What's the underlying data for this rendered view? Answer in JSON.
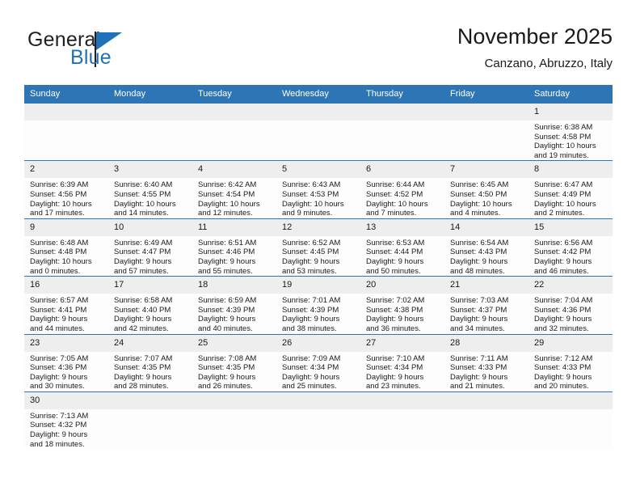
{
  "brand": {
    "word1": "General",
    "word2": "Blue",
    "logo_color": "#1f72b8"
  },
  "header": {
    "title": "November 2025",
    "subtitle": "Canzano, Abruzzo, Italy"
  },
  "theme": {
    "header_bg": "#2e75b6",
    "daynum_bg": "#eeeeee",
    "grid_line": "#2e75b6",
    "text": "#1a1a1a"
  },
  "calendar": {
    "weekday_headers": [
      "Sunday",
      "Monday",
      "Tuesday",
      "Wednesday",
      "Thursday",
      "Friday",
      "Saturday"
    ],
    "weeks": [
      [
        {
          "day": "",
          "empty": true,
          "sunrise": "",
          "sunset": "",
          "daylight1": "",
          "daylight2": ""
        },
        {
          "day": "",
          "empty": true,
          "sunrise": "",
          "sunset": "",
          "daylight1": "",
          "daylight2": ""
        },
        {
          "day": "",
          "empty": true,
          "sunrise": "",
          "sunset": "",
          "daylight1": "",
          "daylight2": ""
        },
        {
          "day": "",
          "empty": true,
          "sunrise": "",
          "sunset": "",
          "daylight1": "",
          "daylight2": ""
        },
        {
          "day": "",
          "empty": true,
          "sunrise": "",
          "sunset": "",
          "daylight1": "",
          "daylight2": ""
        },
        {
          "day": "",
          "empty": true,
          "sunrise": "",
          "sunset": "",
          "daylight1": "",
          "daylight2": ""
        },
        {
          "day": "1",
          "sunrise": "Sunrise: 6:38 AM",
          "sunset": "Sunset: 4:58 PM",
          "daylight1": "Daylight: 10 hours",
          "daylight2": "and 19 minutes."
        }
      ],
      [
        {
          "day": "2",
          "sunrise": "Sunrise: 6:39 AM",
          "sunset": "Sunset: 4:56 PM",
          "daylight1": "Daylight: 10 hours",
          "daylight2": "and 17 minutes."
        },
        {
          "day": "3",
          "sunrise": "Sunrise: 6:40 AM",
          "sunset": "Sunset: 4:55 PM",
          "daylight1": "Daylight: 10 hours",
          "daylight2": "and 14 minutes."
        },
        {
          "day": "4",
          "sunrise": "Sunrise: 6:42 AM",
          "sunset": "Sunset: 4:54 PM",
          "daylight1": "Daylight: 10 hours",
          "daylight2": "and 12 minutes."
        },
        {
          "day": "5",
          "sunrise": "Sunrise: 6:43 AM",
          "sunset": "Sunset: 4:53 PM",
          "daylight1": "Daylight: 10 hours",
          "daylight2": "and 9 minutes."
        },
        {
          "day": "6",
          "sunrise": "Sunrise: 6:44 AM",
          "sunset": "Sunset: 4:52 PM",
          "daylight1": "Daylight: 10 hours",
          "daylight2": "and 7 minutes."
        },
        {
          "day": "7",
          "sunrise": "Sunrise: 6:45 AM",
          "sunset": "Sunset: 4:50 PM",
          "daylight1": "Daylight: 10 hours",
          "daylight2": "and 4 minutes."
        },
        {
          "day": "8",
          "sunrise": "Sunrise: 6:47 AM",
          "sunset": "Sunset: 4:49 PM",
          "daylight1": "Daylight: 10 hours",
          "daylight2": "and 2 minutes."
        }
      ],
      [
        {
          "day": "9",
          "sunrise": "Sunrise: 6:48 AM",
          "sunset": "Sunset: 4:48 PM",
          "daylight1": "Daylight: 10 hours",
          "daylight2": "and 0 minutes."
        },
        {
          "day": "10",
          "sunrise": "Sunrise: 6:49 AM",
          "sunset": "Sunset: 4:47 PM",
          "daylight1": "Daylight: 9 hours",
          "daylight2": "and 57 minutes."
        },
        {
          "day": "11",
          "sunrise": "Sunrise: 6:51 AM",
          "sunset": "Sunset: 4:46 PM",
          "daylight1": "Daylight: 9 hours",
          "daylight2": "and 55 minutes."
        },
        {
          "day": "12",
          "sunrise": "Sunrise: 6:52 AM",
          "sunset": "Sunset: 4:45 PM",
          "daylight1": "Daylight: 9 hours",
          "daylight2": "and 53 minutes."
        },
        {
          "day": "13",
          "sunrise": "Sunrise: 6:53 AM",
          "sunset": "Sunset: 4:44 PM",
          "daylight1": "Daylight: 9 hours",
          "daylight2": "and 50 minutes."
        },
        {
          "day": "14",
          "sunrise": "Sunrise: 6:54 AM",
          "sunset": "Sunset: 4:43 PM",
          "daylight1": "Daylight: 9 hours",
          "daylight2": "and 48 minutes."
        },
        {
          "day": "15",
          "sunrise": "Sunrise: 6:56 AM",
          "sunset": "Sunset: 4:42 PM",
          "daylight1": "Daylight: 9 hours",
          "daylight2": "and 46 minutes."
        }
      ],
      [
        {
          "day": "16",
          "sunrise": "Sunrise: 6:57 AM",
          "sunset": "Sunset: 4:41 PM",
          "daylight1": "Daylight: 9 hours",
          "daylight2": "and 44 minutes."
        },
        {
          "day": "17",
          "sunrise": "Sunrise: 6:58 AM",
          "sunset": "Sunset: 4:40 PM",
          "daylight1": "Daylight: 9 hours",
          "daylight2": "and 42 minutes."
        },
        {
          "day": "18",
          "sunrise": "Sunrise: 6:59 AM",
          "sunset": "Sunset: 4:39 PM",
          "daylight1": "Daylight: 9 hours",
          "daylight2": "and 40 minutes."
        },
        {
          "day": "19",
          "sunrise": "Sunrise: 7:01 AM",
          "sunset": "Sunset: 4:39 PM",
          "daylight1": "Daylight: 9 hours",
          "daylight2": "and 38 minutes."
        },
        {
          "day": "20",
          "sunrise": "Sunrise: 7:02 AM",
          "sunset": "Sunset: 4:38 PM",
          "daylight1": "Daylight: 9 hours",
          "daylight2": "and 36 minutes."
        },
        {
          "day": "21",
          "sunrise": "Sunrise: 7:03 AM",
          "sunset": "Sunset: 4:37 PM",
          "daylight1": "Daylight: 9 hours",
          "daylight2": "and 34 minutes."
        },
        {
          "day": "22",
          "sunrise": "Sunrise: 7:04 AM",
          "sunset": "Sunset: 4:36 PM",
          "daylight1": "Daylight: 9 hours",
          "daylight2": "and 32 minutes."
        }
      ],
      [
        {
          "day": "23",
          "sunrise": "Sunrise: 7:05 AM",
          "sunset": "Sunset: 4:36 PM",
          "daylight1": "Daylight: 9 hours",
          "daylight2": "and 30 minutes."
        },
        {
          "day": "24",
          "sunrise": "Sunrise: 7:07 AM",
          "sunset": "Sunset: 4:35 PM",
          "daylight1": "Daylight: 9 hours",
          "daylight2": "and 28 minutes."
        },
        {
          "day": "25",
          "sunrise": "Sunrise: 7:08 AM",
          "sunset": "Sunset: 4:35 PM",
          "daylight1": "Daylight: 9 hours",
          "daylight2": "and 26 minutes."
        },
        {
          "day": "26",
          "sunrise": "Sunrise: 7:09 AM",
          "sunset": "Sunset: 4:34 PM",
          "daylight1": "Daylight: 9 hours",
          "daylight2": "and 25 minutes."
        },
        {
          "day": "27",
          "sunrise": "Sunrise: 7:10 AM",
          "sunset": "Sunset: 4:34 PM",
          "daylight1": "Daylight: 9 hours",
          "daylight2": "and 23 minutes."
        },
        {
          "day": "28",
          "sunrise": "Sunrise: 7:11 AM",
          "sunset": "Sunset: 4:33 PM",
          "daylight1": "Daylight: 9 hours",
          "daylight2": "and 21 minutes."
        },
        {
          "day": "29",
          "sunrise": "Sunrise: 7:12 AM",
          "sunset": "Sunset: 4:33 PM",
          "daylight1": "Daylight: 9 hours",
          "daylight2": "and 20 minutes."
        }
      ],
      [
        {
          "day": "30",
          "sunrise": "Sunrise: 7:13 AM",
          "sunset": "Sunset: 4:32 PM",
          "daylight1": "Daylight: 9 hours",
          "daylight2": "and 18 minutes."
        },
        {
          "day": "",
          "empty": true,
          "sunrise": "",
          "sunset": "",
          "daylight1": "",
          "daylight2": ""
        },
        {
          "day": "",
          "empty": true,
          "sunrise": "",
          "sunset": "",
          "daylight1": "",
          "daylight2": ""
        },
        {
          "day": "",
          "empty": true,
          "sunrise": "",
          "sunset": "",
          "daylight1": "",
          "daylight2": ""
        },
        {
          "day": "",
          "empty": true,
          "sunrise": "",
          "sunset": "",
          "daylight1": "",
          "daylight2": ""
        },
        {
          "day": "",
          "empty": true,
          "sunrise": "",
          "sunset": "",
          "daylight1": "",
          "daylight2": ""
        },
        {
          "day": "",
          "empty": true,
          "sunrise": "",
          "sunset": "",
          "daylight1": "",
          "daylight2": ""
        }
      ]
    ]
  }
}
